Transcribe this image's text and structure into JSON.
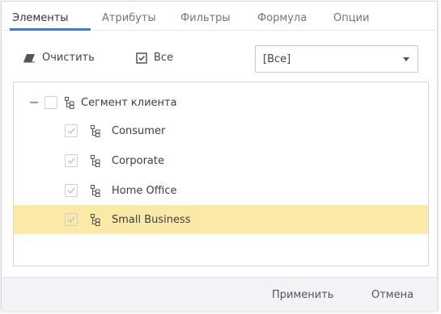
{
  "tabs": [
    {
      "label": "Элементы",
      "active": true
    },
    {
      "label": "Атрибуты",
      "active": false
    },
    {
      "label": "Фильтры",
      "active": false
    },
    {
      "label": "Формула",
      "active": false
    },
    {
      "label": "Опции",
      "active": false
    }
  ],
  "toolbar": {
    "clear_label": "Очистить",
    "all_label": "Все",
    "select_value": "[Все]"
  },
  "tree": {
    "root": {
      "label": "Сегмент клиента",
      "expanded": true,
      "checked": false
    },
    "children": [
      {
        "label": "Consumer",
        "checked": true,
        "selected": false
      },
      {
        "label": "Corporate",
        "checked": true,
        "selected": false
      },
      {
        "label": "Home Office",
        "checked": true,
        "selected": false
      },
      {
        "label": "Small Business",
        "checked": true,
        "selected": true
      }
    ]
  },
  "footer": {
    "apply_label": "Применить",
    "cancel_label": "Отмена"
  },
  "colors": {
    "accent": "#3b7ae0",
    "selected_row": "#fbe9a7",
    "footer_bg": "#f2f3f7"
  },
  "icons": {
    "clear": "eraser-icon",
    "all": "checkbox-checked-icon",
    "dropdown": "caret-down-icon",
    "hierarchy": "hierarchy-icon",
    "collapse": "minus-icon",
    "check": "checkmark-icon"
  }
}
